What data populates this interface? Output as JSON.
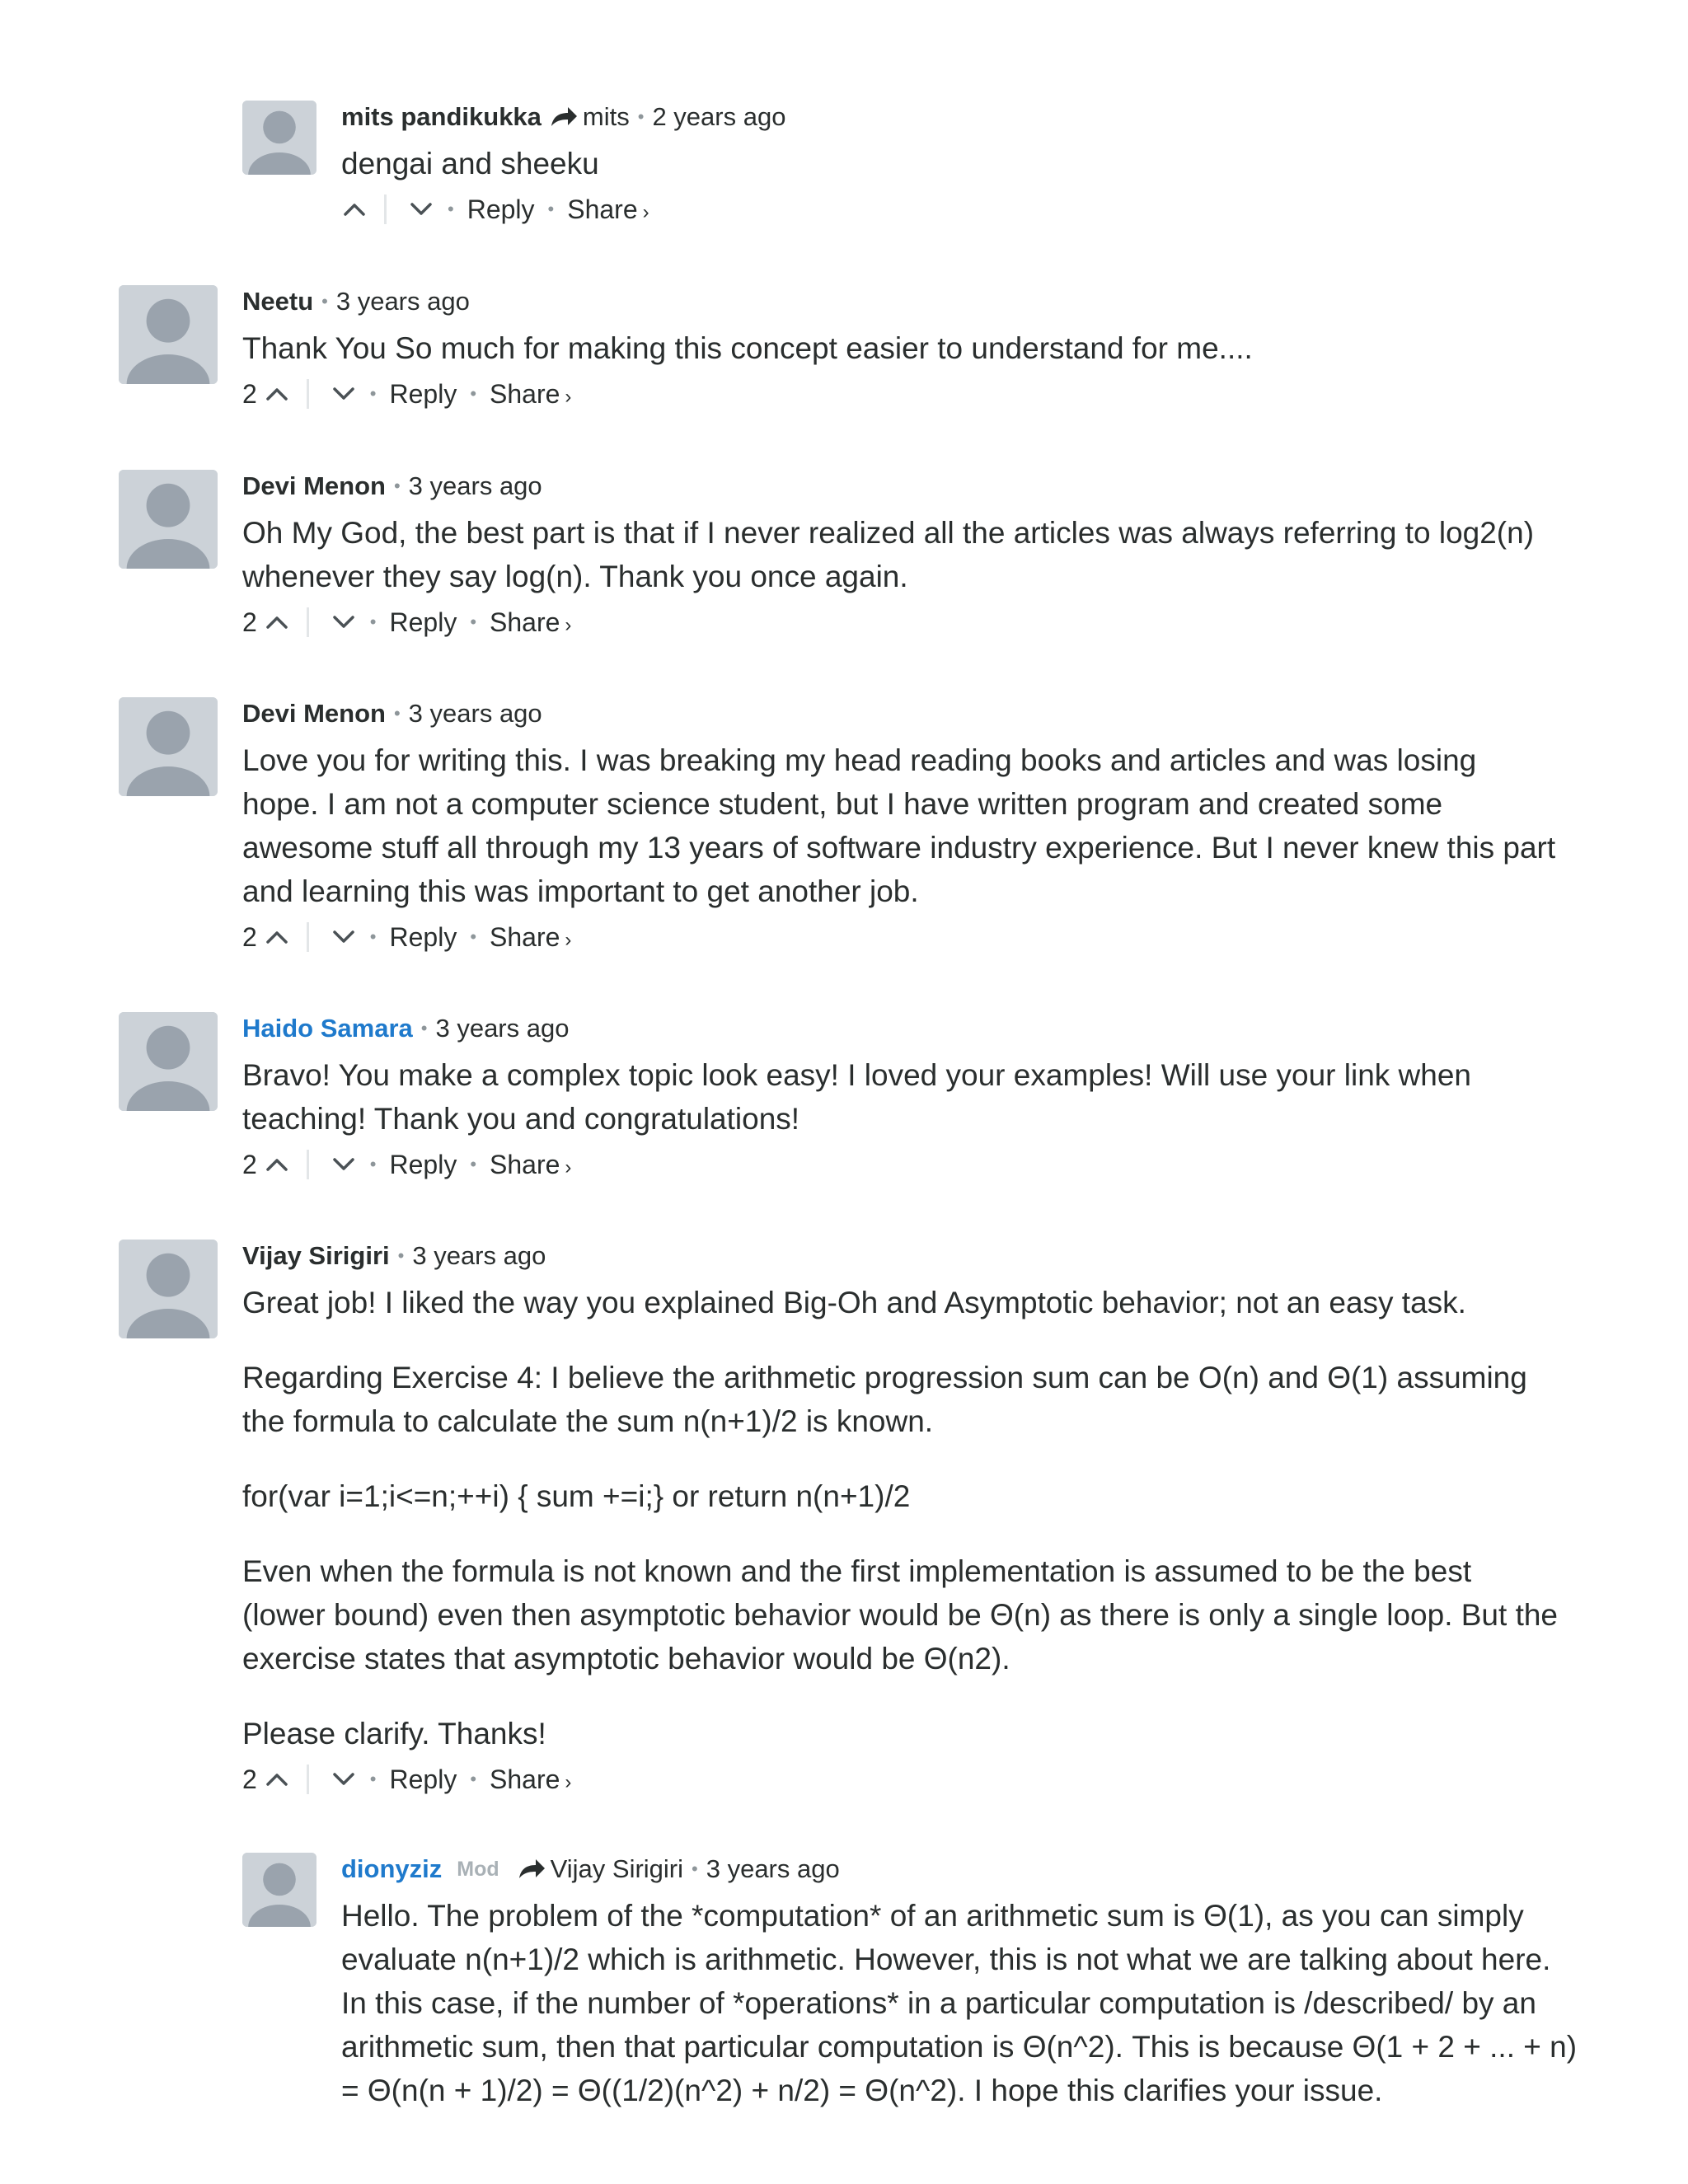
{
  "ui": {
    "separator": "•",
    "share_caret": "›",
    "reply_label": "Reply",
    "share_label": "Share"
  },
  "comments": [
    {
      "author": "mits pandikukka",
      "reply_to": "mits",
      "time": "2 years ago",
      "paragraphs": [
        "dengai and sheeku"
      ],
      "score": ""
    },
    {
      "author": "Neetu",
      "time": "3 years ago",
      "paragraphs": [
        "Thank You So much for making this concept easier to understand for me...."
      ],
      "score": "2"
    },
    {
      "author": "Devi Menon",
      "time": "3 years ago",
      "paragraphs": [
        "Oh My God, the best part is that if I never realized all the articles was always referring to log2(n) whenever they say log(n). Thank you once again."
      ],
      "score": "2"
    },
    {
      "author": "Devi Menon",
      "time": "3 years ago",
      "paragraphs": [
        "Love you for writing this. I was breaking my head reading books and articles and was losing hope. I am not a computer science student, but I have written program and created some awesome stuff all through my 13 years of software industry experience. But I never knew this part and learning this was important to get another job."
      ],
      "score": "2"
    },
    {
      "author": "Haido Samara",
      "time": "3 years ago",
      "paragraphs": [
        "Bravo! You make a complex topic look easy! I loved your examples! Will use your link when teaching! Thank you and congratulations!"
      ],
      "score": "2"
    },
    {
      "author": "Vijay Sirigiri",
      "time": "3 years ago",
      "paragraphs": [
        "Great job! I liked the way you explained Big-Oh and Asymptotic behavior; not an easy task.",
        "Regarding Exercise 4: I believe the arithmetic progression sum can be O(n) and Θ(1) assuming the formula to calculate the sum n(n+1)/2 is known.",
        "for(var i=1;i<=n;++i) { sum +=i;} or return n(n+1)/2",
        "Even when the formula is not known and the first implementation is assumed to be the best (lower bound) even then asymptotic behavior would be Θ(n) as there is only a single loop. But the exercise states that asymptotic behavior would be Θ(n2).",
        "Please clarify. Thanks!"
      ],
      "score": "2"
    },
    {
      "author": "dionyziz",
      "badge": "Mod",
      "reply_to": "Vijay Sirigiri",
      "time": "3 years ago",
      "paragraphs": [
        "Hello. The problem of the *computation* of an arithmetic sum is Θ(1), as you can simply evaluate n(n+1)/2 which is arithmetic. However, this is not what we are talking about here. In this case, if the number of *operations* in a particular computation is /described/ by an arithmetic sum, then that particular computation is Θ(n^2). This is because Θ(1 + 2 + ... + n) = Θ(n(n + 1)/2) = Θ((1/2)(n^2) + n/2) = Θ(n^2). I hope this clarifies your issue."
      ]
    }
  ],
  "colors": {
    "link_blue": "#1f7acc",
    "text": "#2a2e2e",
    "muted": "#8e969a",
    "avatar_bg": "#ccd2d8",
    "avatar_fg": "#9aa3ad"
  }
}
